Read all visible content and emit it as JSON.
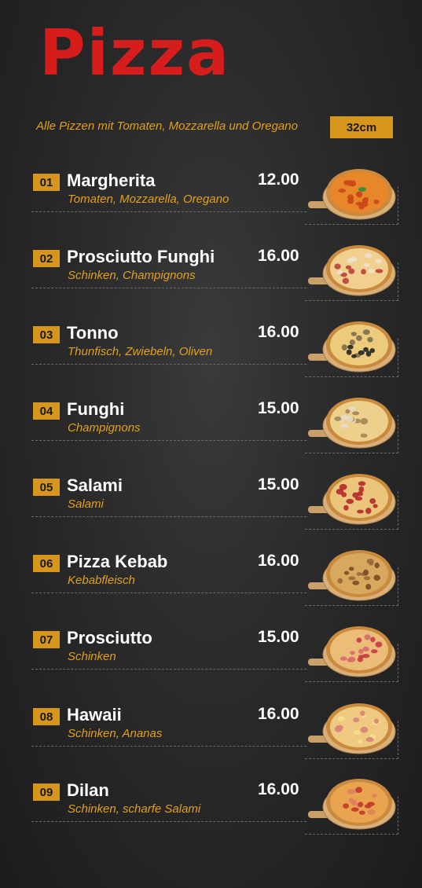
{
  "header": {
    "title": "Pizza",
    "subtitle": "Alle Pizzen mit Tomaten, Mozzarella und Oregano",
    "size_label": "32cm"
  },
  "colors": {
    "accent": "#d6951c",
    "title_red": "#d71c1c",
    "desc_orange": "#e2a01c"
  },
  "items": [
    {
      "num": "01",
      "name": "Margherita",
      "desc": "Tomaten, Mozzarella, Oregano",
      "price": "12.00",
      "topping": "margherita"
    },
    {
      "num": "02",
      "name": "Prosciutto Funghi",
      "desc": "Schinken, Champignons",
      "price": "16.00",
      "topping": "prosciutto-funghi"
    },
    {
      "num": "03",
      "name": "Tonno",
      "desc": "Thunfisch, Zwiebeln, Oliven",
      "price": "16.00",
      "topping": "tonno"
    },
    {
      "num": "04",
      "name": "Funghi",
      "desc": "Champignons",
      "price": "15.00",
      "topping": "funghi"
    },
    {
      "num": "05",
      "name": "Salami",
      "desc": "Salami",
      "price": "15.00",
      "topping": "salami"
    },
    {
      "num": "06",
      "name": "Pizza Kebab",
      "desc": "Kebabfleisch",
      "price": "16.00",
      "topping": "kebab"
    },
    {
      "num": "07",
      "name": "Prosciutto",
      "desc": "Schinken",
      "price": "15.00",
      "topping": "prosciutto"
    },
    {
      "num": "08",
      "name": "Hawaii",
      "desc": "Schinken, Ananas",
      "price": "16.00",
      "topping": "hawaii"
    },
    {
      "num": "09",
      "name": "Dilan",
      "desc": "Schinken, scharfe Salami",
      "price": "16.00",
      "topping": "dilan"
    }
  ]
}
